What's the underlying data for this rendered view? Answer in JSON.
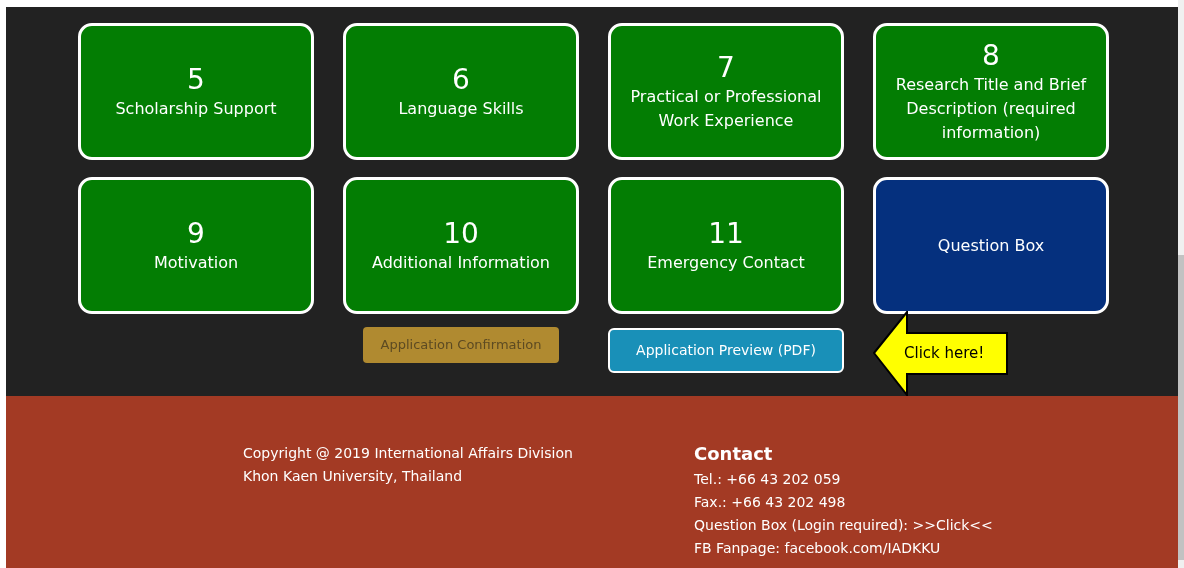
{
  "cards": [
    {
      "kind": "step",
      "number": "5",
      "title": "Scholarship Support"
    },
    {
      "kind": "step",
      "number": "6",
      "title": "Language Skills"
    },
    {
      "kind": "step",
      "number": "7",
      "title": "Practical or Professional Work Experience"
    },
    {
      "kind": "step",
      "number": "8",
      "title": "Research Title and Brief Description (required information)"
    },
    {
      "kind": "step",
      "number": "9",
      "title": "Motivation"
    },
    {
      "kind": "step",
      "number": "10",
      "title": "Additional Information"
    },
    {
      "kind": "step",
      "number": "11",
      "title": "Emergency Contact"
    },
    {
      "kind": "question",
      "title": "Question Box"
    }
  ],
  "buttons": [
    {
      "label": "Application Confirmation",
      "disabled": true
    },
    {
      "label": "Application Preview (PDF)",
      "disabled": false
    }
  ],
  "callout": {
    "text": "Click here!"
  },
  "footer": {
    "copyright": [
      "Copyright @ 2019 International Affairs Division",
      "Khon Kaen University, Thailand"
    ],
    "contact": {
      "heading": "Contact",
      "lines": [
        "Tel.: +66 43 202 059",
        "Fax.: +66 43 202 498",
        "Question Box (Login required): >>Click<<",
        "FB Fanpage: facebook.com/IADKKU"
      ]
    }
  }
}
